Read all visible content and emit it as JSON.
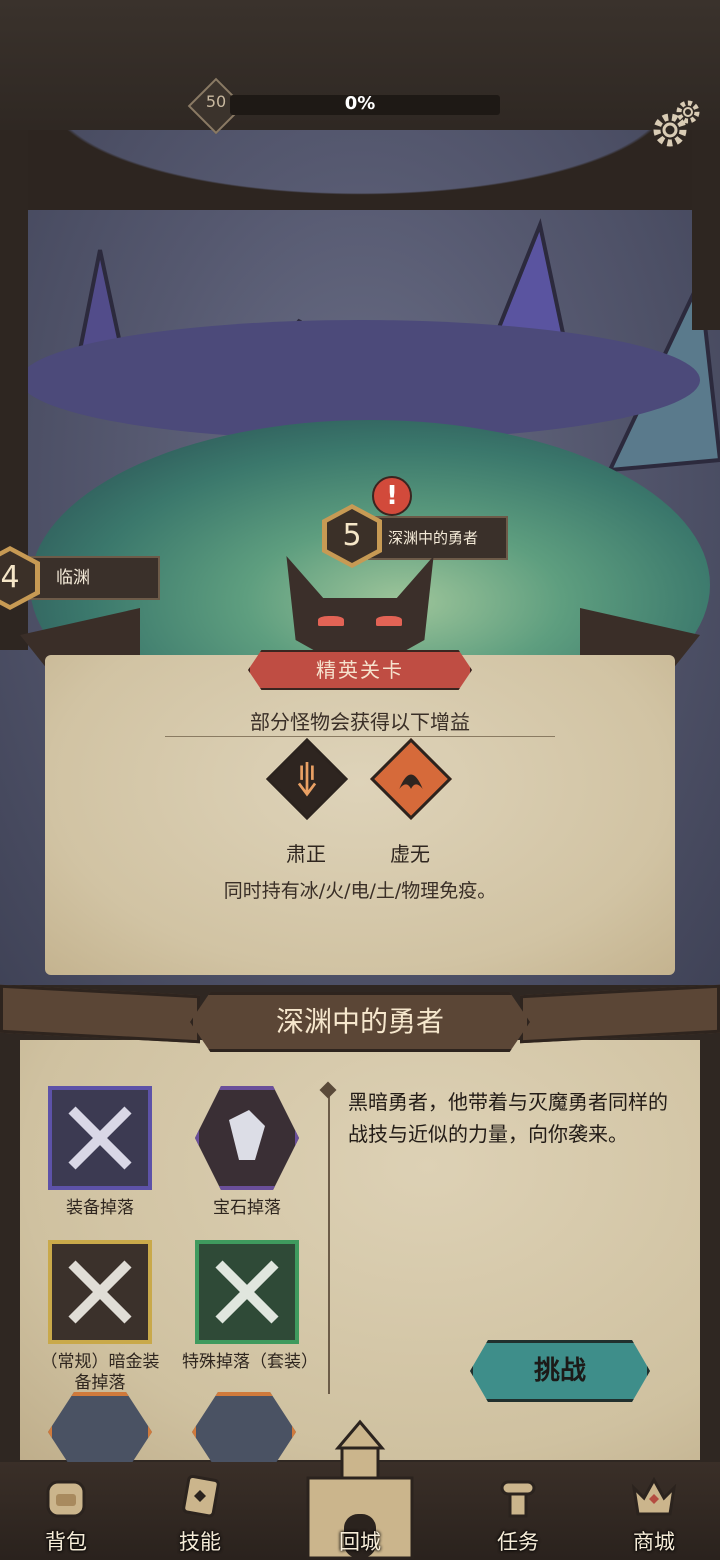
{
  "top": {
    "level": "50",
    "progress_text": "0%",
    "progress_value": 0
  },
  "map": {
    "prev_node": {
      "number": "4",
      "name": "临渊"
    },
    "current_node": {
      "number": "5",
      "name": "深渊中的勇者",
      "alert": "!"
    }
  },
  "elite": {
    "banner": "精英关卡",
    "subtitle": "部分怪物会获得以下增益",
    "buffs": [
      {
        "label": "肃正",
        "icon": "sword-down-icon",
        "color": "#2e2520"
      },
      {
        "label": "虚无",
        "icon": "void-flame-icon",
        "color": "#d66a3a"
      }
    ],
    "description": "同时持有冰/火/电/土/物理免疫。"
  },
  "stage": {
    "title": "深渊中的勇者",
    "drops": [
      {
        "label": "装备掉落",
        "icon": "equipment-drop-icon",
        "color": "#5d52a8"
      },
      {
        "label": "宝石掉落",
        "icon": "gem-drop-icon",
        "color": "#6a4f9a"
      },
      {
        "label": "（常规）暗金装备掉落",
        "icon": "dark-gold-equipment-icon",
        "color": "#c9a94a"
      },
      {
        "label": "特殊掉落（套装）",
        "icon": "set-drop-icon",
        "color": "#3f9a5e"
      }
    ],
    "description": "黑暗勇者，他带着与灭魔勇者同样的战技与近似的力量，向你袭来。",
    "challenge_label": "挑战"
  },
  "nav": {
    "backpack": "背包",
    "skills": "技能",
    "town": "回城",
    "quests": "任务",
    "shop": "商城"
  }
}
